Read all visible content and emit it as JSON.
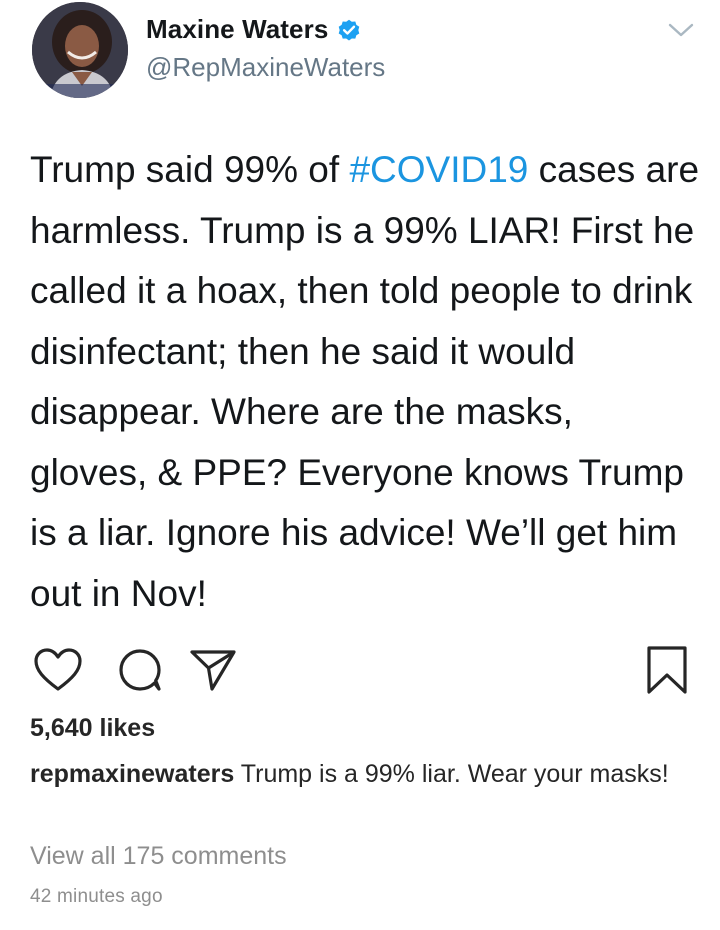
{
  "author": {
    "display_name": "Maxine Waters",
    "handle": "@RepMaxineWaters",
    "verified": true,
    "avatar_icon": "avatar-photo"
  },
  "tweet": {
    "text_before_hashtag": "Trump said 99% of ",
    "hashtag": "#COVID19",
    "text_after_hashtag": " cases are harmless. Trump is a 99% LIAR! First he called it a hoax, then told people to drink disinfectant; then he said it would disappear. Where are the masks, gloves, & PPE? Everyone knows Trump is a liar. Ignore his advice! We’ll get him out in Nov!"
  },
  "actions": {
    "icons": [
      "heart-icon",
      "comment-icon",
      "share-icon",
      "save-icon"
    ]
  },
  "post": {
    "likes": "5,640 likes",
    "caption_user": "repmaxinewaters",
    "caption_text": " Trump is a 99% liar. Wear your masks!",
    "view_comments": "View all 175 comments",
    "timestamp": "42 minutes ago"
  },
  "colors": {
    "hashtag": "#1b95e0",
    "verified_badge": "#1da1f2",
    "secondary_text": "#657786",
    "muted_text": "#8e8e8e"
  }
}
